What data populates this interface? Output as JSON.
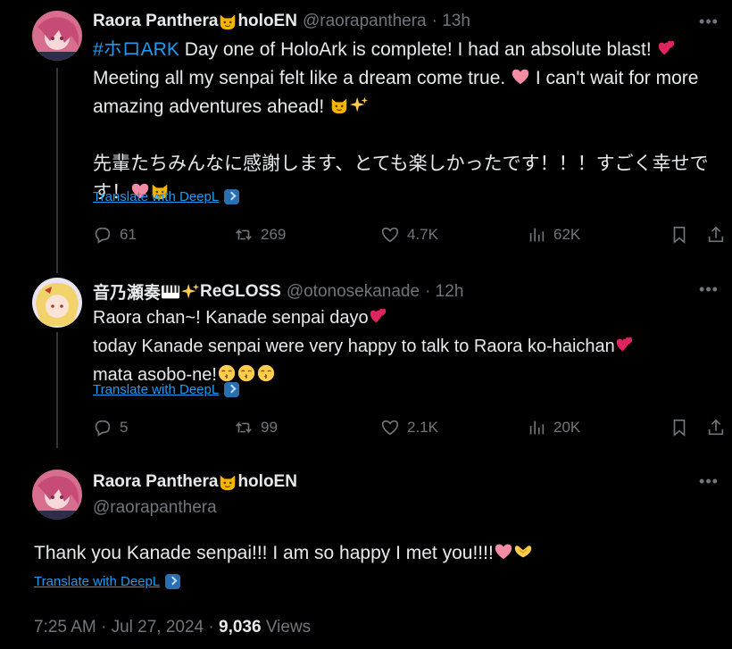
{
  "tweets": [
    {
      "name": "Raora Panthera",
      "name_suffix": "holoEN",
      "handle": "@raorapanthera",
      "time": "· 13h",
      "hashtag": "#ホロARK",
      "text1": " Day one of HoloArk is complete! I had an absolute blast! ",
      "text2": "Meeting all my senpai felt like a dream come true. ",
      "text3": " I can't wait for more",
      "text4": "amazing adventures ahead! ",
      "jp1": "先輩たちみんなに感謝します、とても楽しかったです！！！すごく幸せで",
      "jp2": "す！",
      "translate": "Translate with DeepL",
      "replies": "61",
      "reposts": "269",
      "likes": "4.7K",
      "views": "62K"
    },
    {
      "name": "音乃瀬奏",
      "name_suffix": "ReGLOSS",
      "handle": "@otonosekanade",
      "time": "· 12h",
      "line1": "Raora chan~! Kanade senpai dayo",
      "line2": "today Kanade senpai were very happy to talk to Raora ko-haichan",
      "line3": "mata asobo-ne!",
      "translate": "Translate with DeepL",
      "replies": "5",
      "reposts": "99",
      "likes": "2.1K",
      "views": "20K"
    },
    {
      "name": "Raora Panthera",
      "name_suffix": "holoEN",
      "handle": "@raorapanthera",
      "text": "Thank you Kanade senpai!!! I am so happy I met you!!!!",
      "translate": "Translate with DeepL"
    }
  ],
  "footer": {
    "time": "7:25 AM · Jul 27, 2024 · ",
    "views_count": "9,036",
    "views_label": " Views"
  },
  "icons": [
    "more-icon",
    "reply-icon",
    "repost-icon",
    "like-icon",
    "views-icon",
    "bookmark-icon",
    "share-icon",
    "deepl-icon"
  ],
  "colors": {
    "link": "#1d9bf0",
    "muted": "#71767b",
    "text": "#e7e9ea",
    "background": "#000000"
  }
}
